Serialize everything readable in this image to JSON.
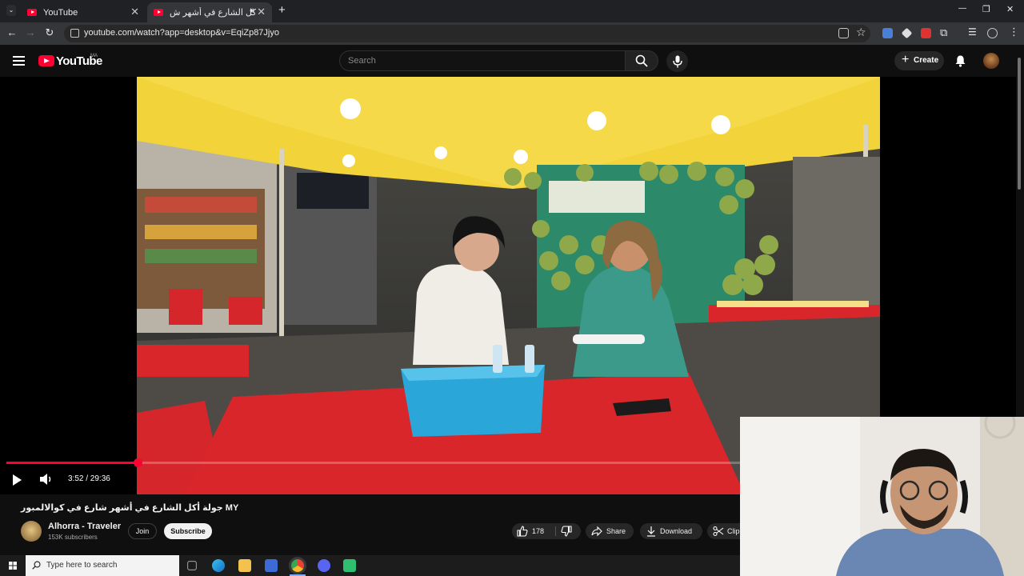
{
  "browser": {
    "tabs": [
      {
        "title": "YouTube",
        "active": false
      },
      {
        "title": "جولة أكل الشارع في أشهر ش",
        "active": true
      }
    ],
    "new_tab": "+",
    "url": "youtube.com/watch?app=desktop&v=EqiZp87Jjyo",
    "window_controls": {
      "minimize": "—",
      "restore": "❐",
      "close": "✕"
    }
  },
  "youtube": {
    "logo_text": "YouTube",
    "country_code": "MA",
    "search_placeholder": "Search",
    "create_label": "Create"
  },
  "player": {
    "time_display": "3:52 / 29:36",
    "progress_fraction": 0.131
  },
  "video": {
    "title": "جولة أكل الشارع في أشهر شارع في كوالالمبور MY",
    "channel_name": "Alhorra - Traveler",
    "subscribers": "153K subscribers",
    "join_label": "Join",
    "subscribe_label": "Subscribe",
    "like_count": "178",
    "share_label": "Share",
    "download_label": "Download",
    "clip_label": "Clip"
  },
  "taskbar": {
    "search_placeholder": "Type here to search"
  },
  "colors": {
    "youtube_red": "#ff0033",
    "background": "#0f0f0f",
    "tent_yellow": "#f2d33a",
    "table_red": "#d8262b",
    "basket_blue": "#2aa7d8"
  }
}
